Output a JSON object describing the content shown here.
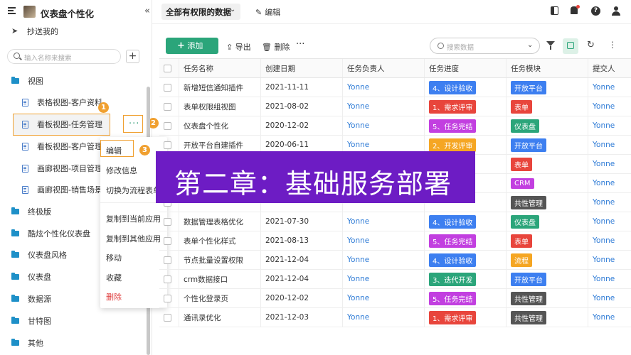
{
  "app": {
    "title": "仪表盘个性化"
  },
  "sidebar": {
    "cc_label": "抄送我的",
    "search_placeholder": "输入名称来搜索",
    "items": [
      {
        "label": "视图",
        "type": "folder"
      },
      {
        "label": "表格视图-客户资料",
        "type": "doc"
      },
      {
        "label": "看板视图-任务管理",
        "type": "doc"
      },
      {
        "label": "看板视图-客户管理",
        "type": "doc"
      },
      {
        "label": "画廊视图-项目管理",
        "type": "doc"
      },
      {
        "label": "画廊视图-销售场景",
        "type": "doc"
      },
      {
        "label": "终极版",
        "type": "folder"
      },
      {
        "label": "酷炫个性化仪表盘",
        "type": "folder"
      },
      {
        "label": "仪表盘风格",
        "type": "folder"
      },
      {
        "label": "仪表盘",
        "type": "folder"
      },
      {
        "label": "数据源",
        "type": "folder"
      },
      {
        "label": "甘特图",
        "type": "folder"
      },
      {
        "label": "其他",
        "type": "folder"
      }
    ],
    "badges": [
      "1",
      "2",
      "3"
    ]
  },
  "context_menu": {
    "items": [
      "编辑",
      "修改信息",
      "切换为流程表单",
      "复制到当前应用",
      "复制到其他应用",
      "移动",
      "收藏",
      "删除"
    ]
  },
  "topbar": {
    "view_name": "全部有权限的数据",
    "edit_label": "编辑"
  },
  "toolbar": {
    "add_label": "添加",
    "export_label": "导出",
    "delete_label": "删除",
    "search_placeholder": "搜索数据"
  },
  "table": {
    "columns": [
      "任务名称",
      "创建日期",
      "任务负责人",
      "任务进度",
      "任务模块",
      "提交人"
    ],
    "rows": [
      {
        "name": "新增短信通知插件",
        "date": "2021-11-11",
        "owner": "Yonne",
        "progress": "4、设计验收",
        "module": "开放平台",
        "submitter": "Yonne"
      },
      {
        "name": "表单权限组视图",
        "date": "2021-08-02",
        "owner": "Yonne",
        "progress": "1、需求评审",
        "module": "表单",
        "submitter": "Yonne"
      },
      {
        "name": "仪表盘个性化",
        "date": "2020-12-02",
        "owner": "Yonne",
        "progress": "5、任务完结",
        "module": "仪表盘",
        "submitter": "Yonne"
      },
      {
        "name": "开放平台自建插件",
        "date": "2020-06-11",
        "owner": "Yonne",
        "progress": "2、开发评审",
        "module": "开放平台",
        "submitter": "Yonne"
      },
      {
        "name": "",
        "date": "",
        "owner": "",
        "progress": "",
        "module": "表单",
        "submitter": "Yonne"
      },
      {
        "name": "",
        "date": "",
        "owner": "",
        "progress": "",
        "module": "CRM",
        "submitter": "Yonne"
      },
      {
        "name": "",
        "date": "",
        "owner": "",
        "progress": "",
        "module": "共性管理",
        "submitter": "Yonne"
      },
      {
        "name": "数据管理表格优化",
        "date": "2021-07-30",
        "owner": "Yonne",
        "progress": "4、设计验收",
        "module": "仪表盘",
        "submitter": "Yonne"
      },
      {
        "name": "表单个性化样式",
        "date": "2021-08-13",
        "owner": "Yonne",
        "progress": "5、任务完结",
        "module": "表单",
        "submitter": "Yonne"
      },
      {
        "name": "节点批量设置权限",
        "date": "2021-12-04",
        "owner": "Yonne",
        "progress": "4、设计验收",
        "module": "流程",
        "submitter": "Yonne"
      },
      {
        "name": "crm数据接口",
        "date": "2021-12-04",
        "owner": "Yonne",
        "progress": "3、迭代开发",
        "module": "开放平台",
        "submitter": "Yonne"
      },
      {
        "name": "个性化登录页",
        "date": "2020-12-02",
        "owner": "Yonne",
        "progress": "5、任务完结",
        "module": "共性管理",
        "submitter": "Yonne"
      },
      {
        "name": "通讯录优化",
        "date": "2021-12-03",
        "owner": "Yonne",
        "progress": "1、需求评审",
        "module": "共性管理",
        "submitter": "Yonne"
      }
    ]
  },
  "colors": {
    "progress": {
      "1": "#e8453c",
      "2": "#f5a623",
      "3": "#2ba57a",
      "4": "#3d7ff0",
      "5": "#c23fe0"
    },
    "module": {
      "开放平台": "#3d7ff0",
      "表单": "#e8453c",
      "仪表盘": "#2ba57a",
      "CRM": "#c23fe0",
      "共性管理": "#555555",
      "流程": "#f5a623"
    },
    "accent": "#2ba57a",
    "highlight": "#f0a030",
    "banner": "#6d1cc4"
  },
  "banner": {
    "text": "第二章：基础服务部署"
  }
}
